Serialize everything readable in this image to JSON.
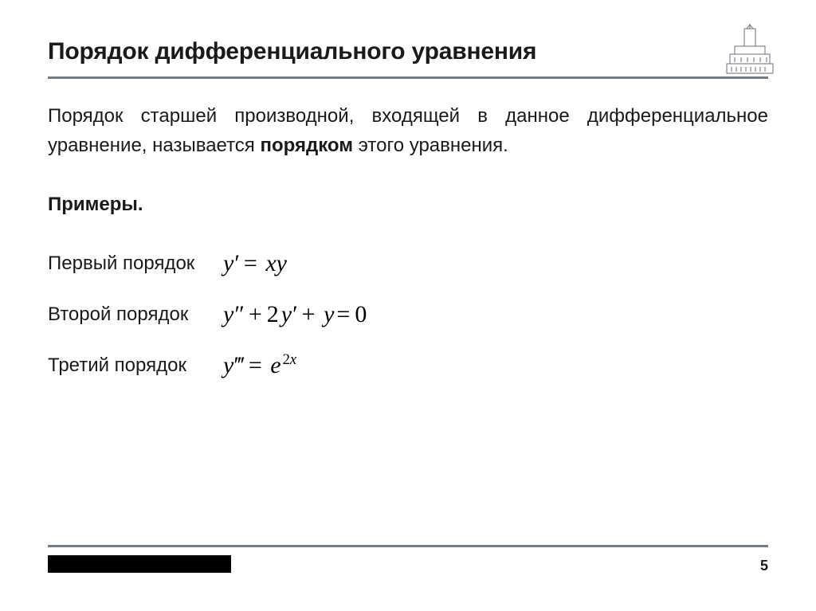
{
  "header": {
    "title": "Порядок дифференциального уравнения"
  },
  "definition": {
    "pre": "Порядок старшей производной, входящей в данное дифференциальное уравнение, называется ",
    "bold": "порядком",
    "post": " этого уравнения."
  },
  "examples": {
    "label": "Примеры.",
    "items": [
      {
        "label": "Первый порядок",
        "equation_key": "eq1"
      },
      {
        "label": "Второй порядок",
        "equation_key": "eq2"
      },
      {
        "label": "Третий порядок",
        "equation_key": "eq3"
      }
    ]
  },
  "equations": {
    "eq1": "y′ = xy",
    "eq2": "y″ + 2y′ + y = 0",
    "eq3": "y‴ = e^{2x}"
  },
  "page_number": "5"
}
